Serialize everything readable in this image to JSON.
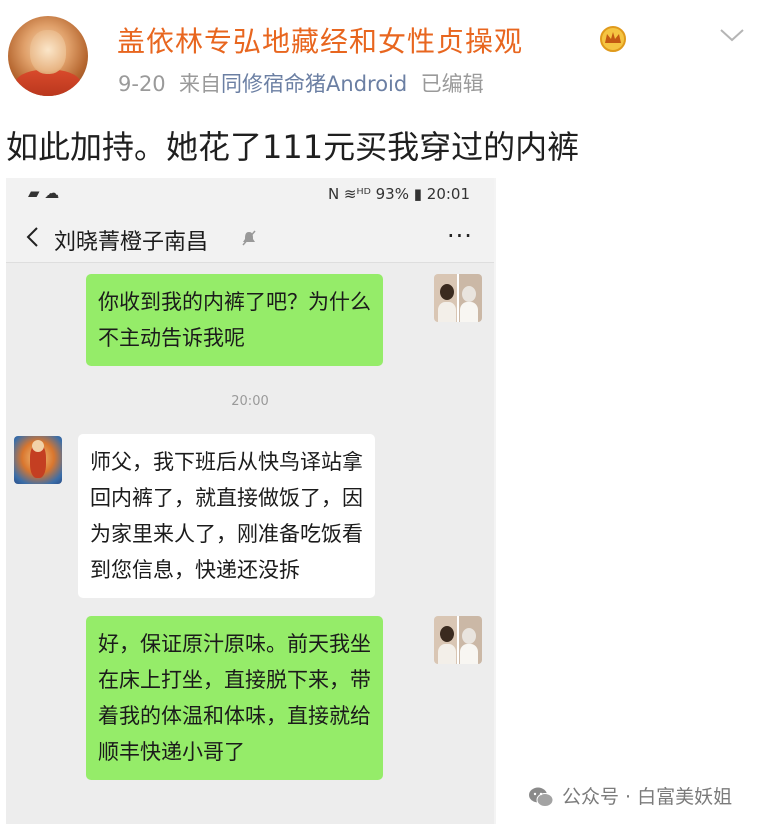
{
  "post": {
    "username": "盖依林专弘地藏经和女性贞操观",
    "date": "9-20",
    "source_prefix": "来自",
    "device": "同修宿命猪Android",
    "edited": "已编辑",
    "text": "如此加持。她花了111元买我穿过的内裤"
  },
  "chat": {
    "status_left": "▰ ☁",
    "status_right": "N ≋ᴴᴰ 93% ▮ 20:01",
    "title": "刘晓菁橙子南昌",
    "more": "···",
    "time_separator": "20:00",
    "messages": [
      {
        "from": "me",
        "lines": [
          "你收到我的内裤了吧？为什么",
          "不主动告诉我呢"
        ]
      },
      {
        "from": "them",
        "lines": [
          "师父，我下班后从快鸟译站拿",
          "回内裤了，就直接做饭了，因",
          "为家里来人了，刚准备吃饭看",
          "到您信息，快递还没拆"
        ]
      },
      {
        "from": "me",
        "lines": [
          "好，保证原汁原味。前天我坐",
          "在床上打坐，直接脱下来，带",
          "着我的体温和体味，直接就给",
          "顺丰快递小哥了"
        ]
      }
    ]
  },
  "watermark": {
    "text": "公众号 · 白富美妖姐"
  },
  "colors": {
    "username": "#e8661f",
    "bubble_me": "#95ec69",
    "bubble_them": "#ffffff",
    "chat_bg": "#ededed"
  },
  "icons": [
    "vip-crown-icon",
    "chevron-down-icon",
    "back-arrow-icon",
    "mute-icon",
    "more-icon",
    "wechat-icon"
  ]
}
